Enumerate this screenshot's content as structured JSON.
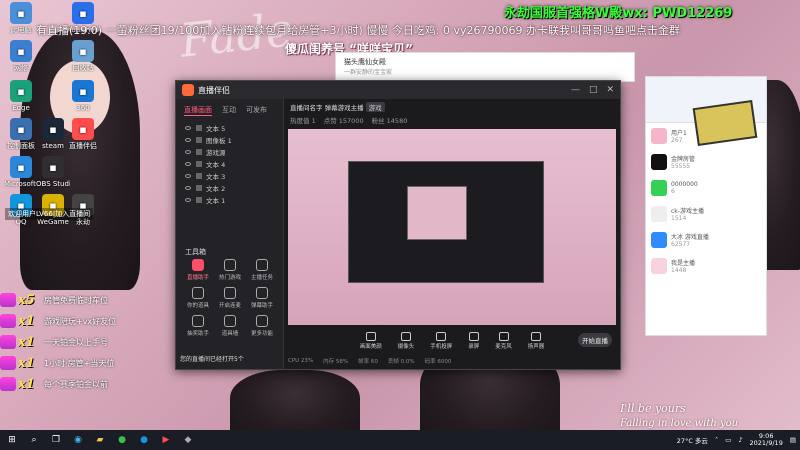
{
  "overlay": {
    "ticker": "有直播(19.0)  一萤粉丝团19/100加入钻粉连续包月给房管+3小时)  慢慢 今日吃鸡: 0 vy26790069 办卡联我叫哥哥吗鱼吧点击金群",
    "banner": "永劫国服首强格W殿wx:  PWD12269",
    "subbanner": "傻瓜闺养号 “咩咩宝贝”",
    "big_letters": "Fade"
  },
  "desktop_icons": [
    {
      "label": "此电脑",
      "icon": "pc-icon",
      "color": "#4a90d9"
    },
    {
      "label": "Kuaishou",
      "icon": "kuaishou-icon",
      "color": "#2a6fe8"
    },
    {
      "label": "网络",
      "icon": "network-icon",
      "color": "#3a7fd0"
    },
    {
      "label": "回收站",
      "icon": "recycle-bin-icon",
      "color": "#6aa0d0"
    },
    {
      "label": "Edge",
      "icon": "edge-icon",
      "color": "#1aa07a"
    },
    {
      "label": "360",
      "icon": "browser-icon",
      "color": "#1877d2"
    },
    {
      "label": "控制面板",
      "icon": "control-panel-icon",
      "color": "#3a6fb0"
    },
    {
      "label": "steam",
      "icon": "steam-icon",
      "color": "#1b2838"
    },
    {
      "label": "直播伴侣",
      "icon": "live-icon",
      "color": "#ff4d4d"
    },
    {
      "label": "Microsoft Edge",
      "icon": "edge2-icon",
      "color": "#2b88d8"
    },
    {
      "label": "OBS Studio",
      "icon": "obs-icon",
      "color": "#302e31"
    },
    {
      "label": "QQ",
      "icon": "qq-icon",
      "color": "#1296db"
    },
    {
      "label": "WeGame",
      "icon": "wegame-icon",
      "color": "#d9b100"
    },
    {
      "label": "永劫",
      "icon": "game-icon",
      "color": "#444"
    }
  ],
  "chat_line": "欢迎用户LV66|加入直播间",
  "gifts": [
    {
      "count": "x5",
      "text": "房管免费临时车位"
    },
    {
      "count": "x1",
      "text": "游戏陪玩+vx好友位"
    },
    {
      "count": "x1",
      "text": "一天铂金以上手号"
    },
    {
      "count": "x1",
      "text": "1小时·房管+当天位"
    },
    {
      "count": "x1",
      "text": "每个赛季铂金以前"
    }
  ],
  "streamer_window": {
    "title": "直播伴侣",
    "tabs": [
      "直播画面",
      "互动",
      "可发布"
    ],
    "sources": [
      "文本 5",
      "图像板 1",
      "游戏源",
      "文本 4",
      "文本 3",
      "文本 2",
      "文本 1"
    ],
    "tools_title": "工具箱",
    "tools": [
      "直播助手",
      "热门游戏",
      "主播任务",
      "你的道具",
      "开启连麦",
      "弹幕助手",
      "抽奖助手",
      "道具墙",
      "更多功能"
    ],
    "notice": "您的直播间已经打开5个",
    "room_title": "直播间名字 弹幕游戏主播",
    "room_tag": "游戏",
    "stats": [
      "热度值 1",
      "点赞 157000",
      "粉丝 14580"
    ],
    "bottom_buttons": [
      "画面美颜",
      "摄像头",
      "手机投屏",
      "录屏",
      "麦克风",
      "扬声器"
    ],
    "start_button": "开始直播",
    "status_items": [
      "CPU 23%",
      "内存 58%",
      "帧率 60",
      "丢帧 0.0%",
      "码率 6000"
    ]
  },
  "chat_window": {
    "top_title": "猫头鹰仙女殿",
    "top_sub": "一群安静的宝宝家",
    "contacts": [
      {
        "name": "用户1",
        "count": "267",
        "color": "#f4b6c8"
      },
      {
        "name": "金牌房管",
        "count": "55555",
        "color": "#111"
      },
      {
        "name": "0000000",
        "count": "6",
        "color": "#34d058"
      },
      {
        "name": "ck-游戏主播",
        "count": "1514",
        "color": "#eee"
      },
      {
        "name": "大冰 游戏直播",
        "count": "62577",
        "color": "#2f8cff"
      },
      {
        "name": "我是主播",
        "count": "1448",
        "color": "#f7d3e0"
      }
    ]
  },
  "cursive": [
    "I'll be yours",
    "Falling in love with you"
  ],
  "taskbar": {
    "weather": "27°C 多云",
    "time": "9:06",
    "date": "2021/9/19"
  }
}
